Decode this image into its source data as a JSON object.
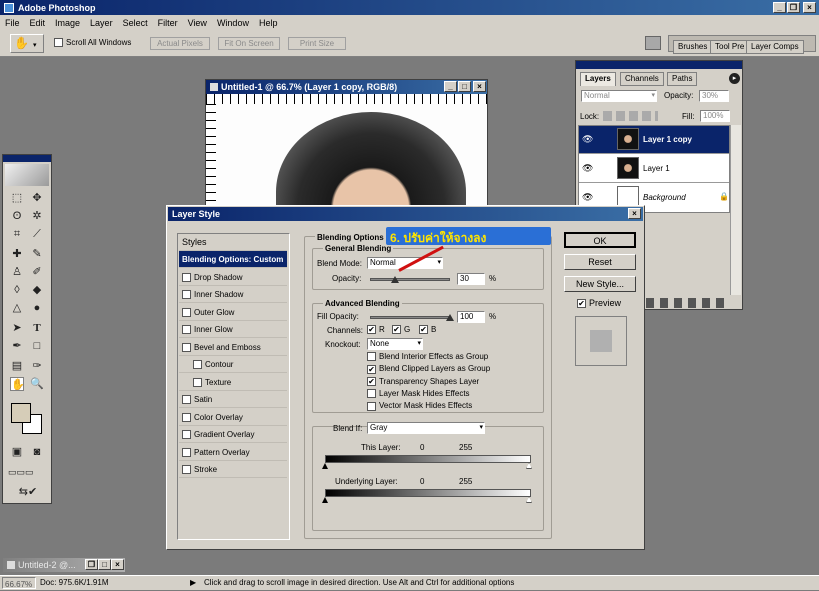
{
  "app": {
    "title": "Adobe Photoshop"
  },
  "menu": [
    "File",
    "Edit",
    "Image",
    "Layer",
    "Select",
    "Filter",
    "View",
    "Window",
    "Help"
  ],
  "options": {
    "scroll_all": "Scroll All Windows",
    "actual_pixels": "Actual Pixels",
    "fit_on_screen": "Fit On Screen",
    "print_size": "Print Size"
  },
  "palette_well": [
    "Brushes",
    "Tool Pre",
    "Layer Comps"
  ],
  "document": {
    "title": "Untitled-1 @ 66.7% (Layer 1 copy, RGB/8)"
  },
  "layers_panel": {
    "tabs": [
      "Layers",
      "Channels",
      "Paths"
    ],
    "blend_mode": "Normal",
    "opacity_label": "Opacity:",
    "opacity_value": "30%",
    "lock_label": "Lock:",
    "fill_label": "Fill:",
    "fill_value": "100%",
    "layers": [
      "Layer 1 copy",
      "Layer 1",
      "Background"
    ]
  },
  "dialog": {
    "title": "Layer Style",
    "styles_header": "Styles",
    "styles": [
      {
        "label": "Blending Options: Custom",
        "checkbox": false,
        "selected": true
      },
      {
        "label": "Drop Shadow",
        "checkbox": true
      },
      {
        "label": "Inner Shadow",
        "checkbox": true
      },
      {
        "label": "Outer Glow",
        "checkbox": true
      },
      {
        "label": "Inner Glow",
        "checkbox": true
      },
      {
        "label": "Bevel and Emboss",
        "checkbox": true
      },
      {
        "label": "Contour",
        "checkbox": true,
        "indent": true
      },
      {
        "label": "Texture",
        "checkbox": true,
        "indent": true
      },
      {
        "label": "Satin",
        "checkbox": true
      },
      {
        "label": "Color Overlay",
        "checkbox": true
      },
      {
        "label": "Gradient Overlay",
        "checkbox": true
      },
      {
        "label": "Pattern Overlay",
        "checkbox": true
      },
      {
        "label": "Stroke",
        "checkbox": true
      }
    ],
    "blending_options": "Blending Options",
    "general_blending": "General Blending",
    "blend_mode_label": "Blend Mode:",
    "blend_mode": "Normal",
    "opacity_label": "Opacity:",
    "opacity_value": "30",
    "percent": "%",
    "advanced_blending": "Advanced Blending",
    "fill_opacity_label": "Fill Opacity:",
    "fill_opacity_value": "100",
    "channels_label": "Channels:",
    "channels": [
      "R",
      "G",
      "B"
    ],
    "knockout_label": "Knockout:",
    "knockout": "None",
    "advanced_options": [
      {
        "label": "Blend Interior Effects as Group",
        "checked": false
      },
      {
        "label": "Blend Clipped Layers as Group",
        "checked": true
      },
      {
        "label": "Transparency Shapes Layer",
        "checked": true
      },
      {
        "label": "Layer Mask Hides Effects",
        "checked": false
      },
      {
        "label": "Vector Mask Hides Effects",
        "checked": false
      }
    ],
    "blend_if_label": "Blend If:",
    "blend_if": "Gray",
    "this_layer_label": "This Layer:",
    "underlying_label": "Underlying Layer:",
    "range_min": "0",
    "range_max": "255",
    "annotation": "6. ปรับค่าให้จางลง",
    "buttons": {
      "ok": "OK",
      "reset": "Reset",
      "new_style": "New Style...",
      "preview": "Preview"
    }
  },
  "minimized": {
    "title": "Untitled-2 @..."
  },
  "status": {
    "zoom": "66.67%",
    "doc": "Doc: 975.6K/1.91M",
    "hint": "Click and drag to scroll image in desired direction.  Use Alt and Ctrl for additional options"
  }
}
